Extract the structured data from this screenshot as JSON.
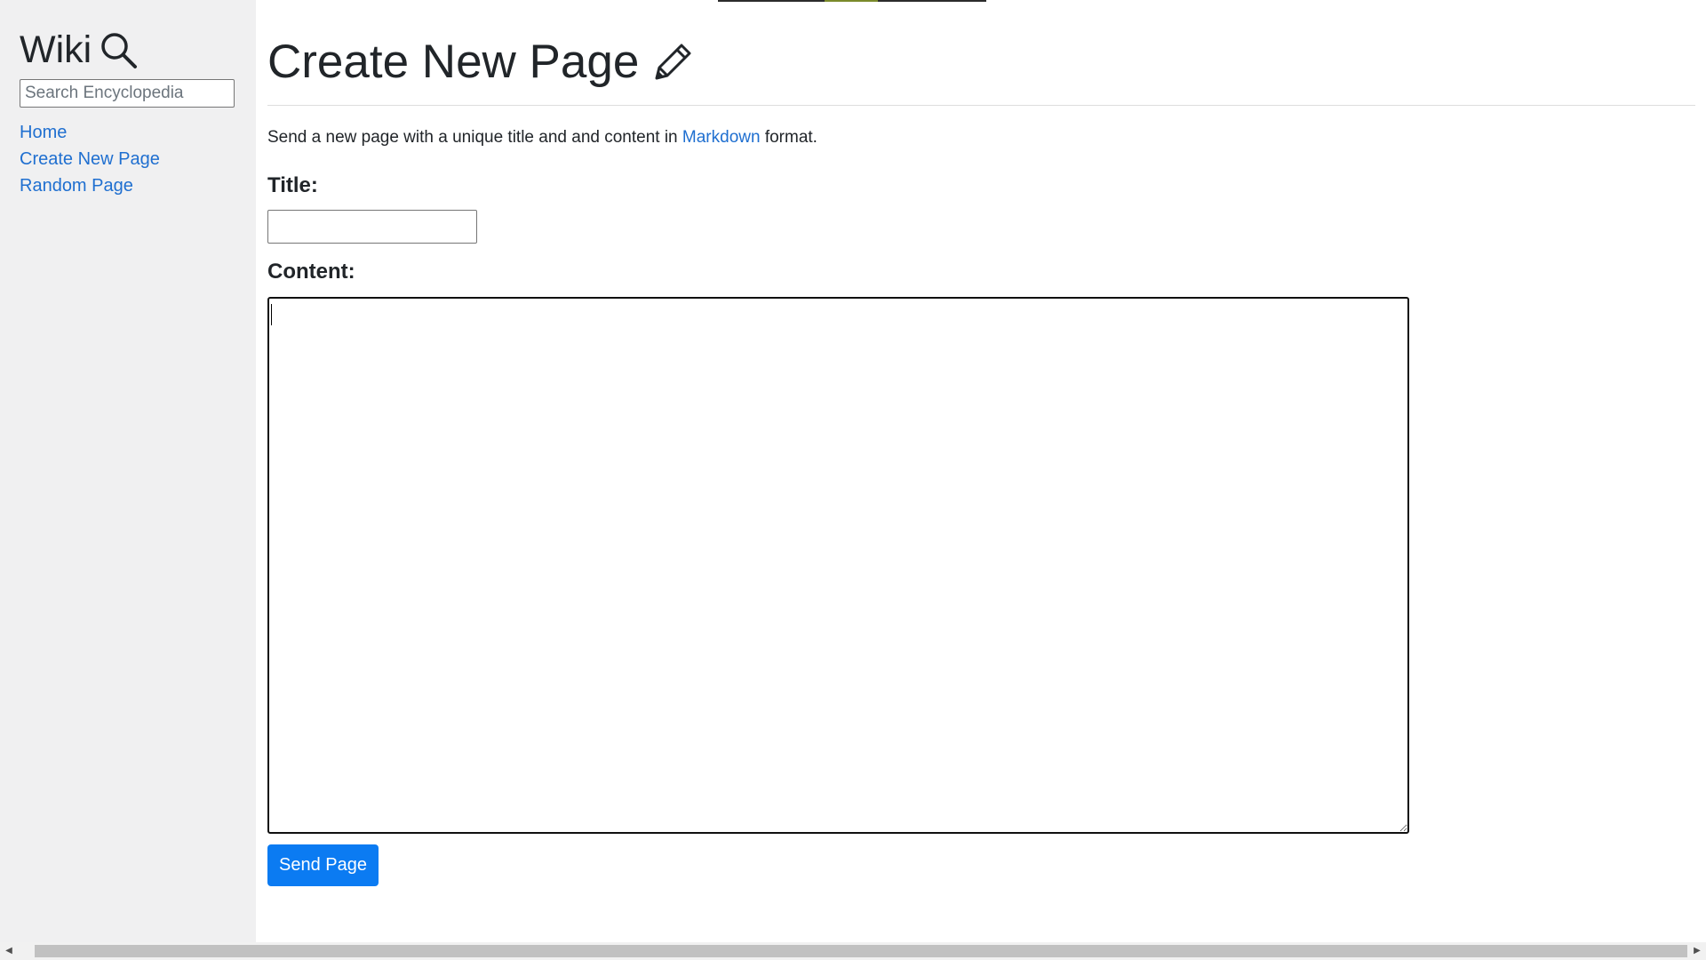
{
  "sidebar": {
    "brand": "Wiki",
    "brand_icon": "magnifier-icon",
    "search": {
      "placeholder": "Search Encyclopedia",
      "value": ""
    },
    "nav": [
      {
        "label": "Home"
      },
      {
        "label": "Create New Page"
      },
      {
        "label": "Random Page"
      }
    ]
  },
  "main": {
    "title": "Create New Page",
    "title_icon": "pencil-icon",
    "intro": {
      "before": "Send a new page with a unique title and and content in ",
      "link": "Markdown",
      "after": " format."
    },
    "title_label": "Title:",
    "title_value": "",
    "content_label": "Content:",
    "content_value": "",
    "submit_label": "Send Page"
  },
  "colors": {
    "sidebar_bg": "#f0f0f1",
    "link": "#1f6fd0",
    "button_bg": "#0b7bf2",
    "text": "#212529"
  }
}
